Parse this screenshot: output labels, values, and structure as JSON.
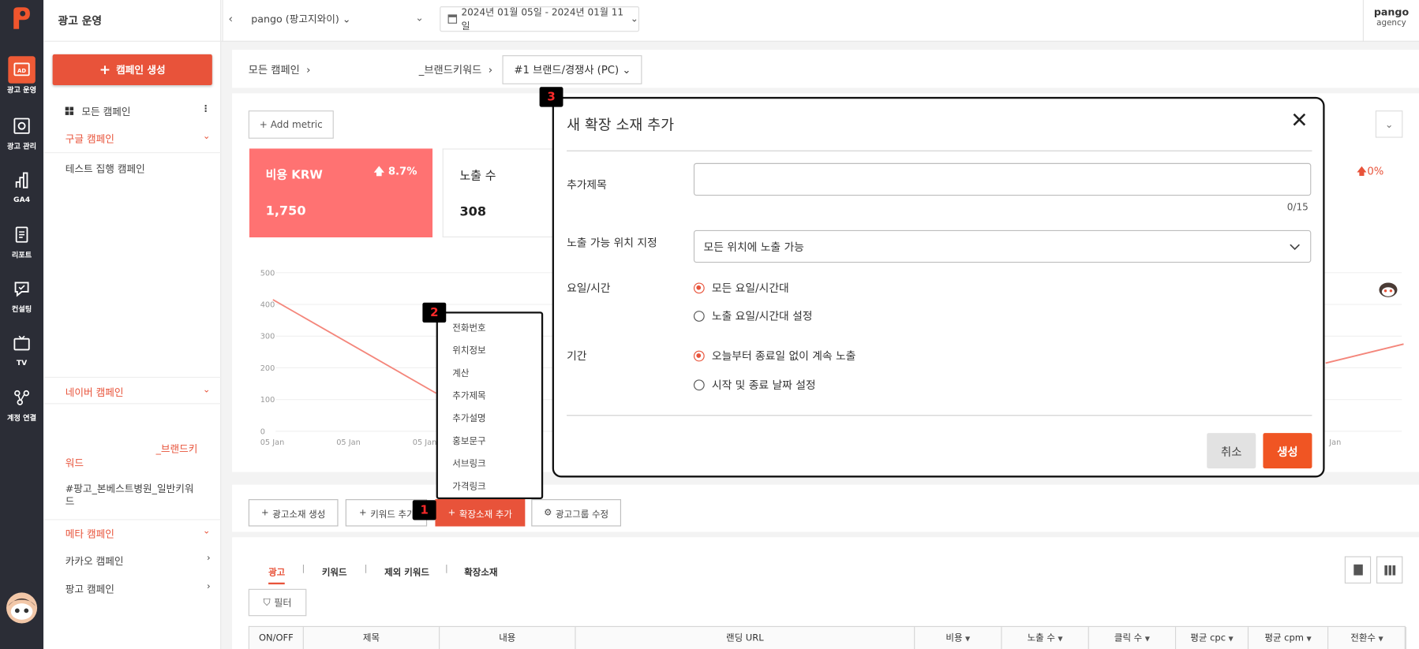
{
  "rail": {
    "items": [
      {
        "label": "광고 운영",
        "icon": "ad-icon",
        "active": true
      },
      {
        "label": "광고 관리",
        "icon": "ad-settings-icon"
      },
      {
        "label": "GA4",
        "icon": "analytics-icon"
      },
      {
        "label": "리포트",
        "icon": "report-icon"
      },
      {
        "label": "컨설팅",
        "icon": "consulting-icon"
      },
      {
        "label": "TV",
        "icon": "tv-icon"
      },
      {
        "label": "계정 연결",
        "icon": "connect-icon"
      }
    ]
  },
  "leftnav": {
    "title": "광고 운영",
    "create_label": "캠페인 생성",
    "all_campaigns": "모든 캠페인",
    "google": "구글 캠페인",
    "google_child": "테스트 집행 캠페인",
    "naver": "네이버 캠페인",
    "naver_child1_a": "_브랜드키",
    "naver_child1_b": "워드",
    "naver_child2": "#팡고_본베스트병원_일반키워드",
    "meta": "메타 캠페인",
    "kakao": "카카오 캠페인",
    "pango": "팡고 캠페인"
  },
  "topbar": {
    "account": "pango (팡고지와이)",
    "date_range": "2024년 01월 05일 - 2024년 01월 11일",
    "agency_name": "pango",
    "agency_sub": "agency"
  },
  "breadcrumb": {
    "all": "모든 캠페인",
    "campaign": "_브랜드키워드",
    "adgroup": "#1 브랜드/경쟁사 (PC)"
  },
  "dashboard": {
    "add_metric": "Add metric",
    "kpis": [
      {
        "label": "비용 KRW",
        "value": "1,750",
        "change": "8.7%"
      },
      {
        "label": "노출 수",
        "value": "308"
      }
    ],
    "right_change": "0%"
  },
  "chart_data": {
    "type": "line",
    "x": [
      "05 Jan",
      "05 Jan",
      "05 Jan"
    ],
    "yticks": [
      "500",
      "400",
      "300",
      "200",
      "100",
      "0"
    ],
    "x_right": "Jan",
    "ylim": [
      0,
      500
    ]
  },
  "actions": {
    "create_ad": "광고소재 생성",
    "add_keyword": "키워드 추가",
    "add_extension": "확장소재 추가",
    "edit_group": "광고그룹 수정"
  },
  "ext_menu": [
    "전화번호",
    "위치정보",
    "계산",
    "추가제목",
    "추가설명",
    "홍보문구",
    "서브링크",
    "가격링크"
  ],
  "badges": [
    "1",
    "2",
    "3"
  ],
  "tabs": [
    "광고",
    "키워드",
    "제외 키워드",
    "확장소재"
  ],
  "filter_label": "필터",
  "table_headers": [
    "ON/OFF",
    "제목",
    "내용",
    "랜딩 URL",
    "비용",
    "노출 수",
    "클릭 수",
    "평균 cpc",
    "평균 cpm",
    "전환수"
  ],
  "modal": {
    "title": "새 확장 소재 추가",
    "field_title_label": "추가제목",
    "title_value": "",
    "title_count": "0/15",
    "position_label": "노출 가능 위치 지정",
    "position_value": "모든 위치에 노출 가능",
    "day_label": "요일/시간",
    "day_opt1": "모든 요일/시간대",
    "day_opt2": "노출 요일/시간대 설정",
    "period_label": "기간",
    "period_opt1": "오늘부터 종료일 없이 계속 노출",
    "period_opt2": "시작 및 종료 날짜 설정",
    "cancel": "취소",
    "create": "생성"
  },
  "colors": {
    "accent": "#e8533a",
    "kpi": "#ff7272",
    "rail": "#2b2d36"
  }
}
